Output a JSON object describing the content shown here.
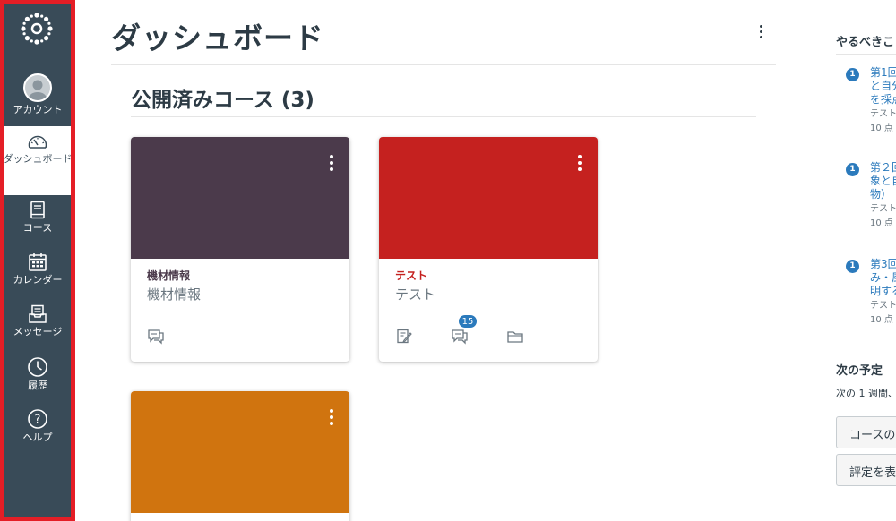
{
  "nav": {
    "account": "アカウント",
    "dashboard": "ダッシュボード",
    "courses": "コース",
    "calendar": "カレンダー",
    "messages": "メッセージ",
    "history": "履歴",
    "help": "ヘルプ"
  },
  "page": {
    "title": "ダッシュボード",
    "section_title": "公開済みコース (3)"
  },
  "cards": [
    {
      "code": "機材情報",
      "name": "機材情報",
      "color": "#4b3a4b",
      "code_color": "#4b3a4b"
    },
    {
      "code": "テスト",
      "name": "テスト",
      "color": "#c5211f",
      "code_color": "#c5211f",
      "badge": "15"
    },
    {
      "code": "",
      "name": "",
      "color": "#d0740f"
    }
  ],
  "todo": {
    "header": "やるべきこ",
    "items": [
      {
        "num": "1",
        "title": "第1回\nと自分\nを採点",
        "course": "テスト",
        "points": "10 点"
      },
      {
        "num": "1",
        "title": "第２回\n象と自\n物）",
        "course": "テスト",
        "points": "10 点"
      },
      {
        "num": "1",
        "title": "第3回\nみ・風\n明する",
        "course": "テスト",
        "points": "10 点"
      }
    ]
  },
  "upcoming": {
    "header": "次の予定",
    "sub": "次の 1 週間、"
  },
  "buttons": {
    "course_btn": "コースの",
    "grades_btn": "評定を表"
  }
}
